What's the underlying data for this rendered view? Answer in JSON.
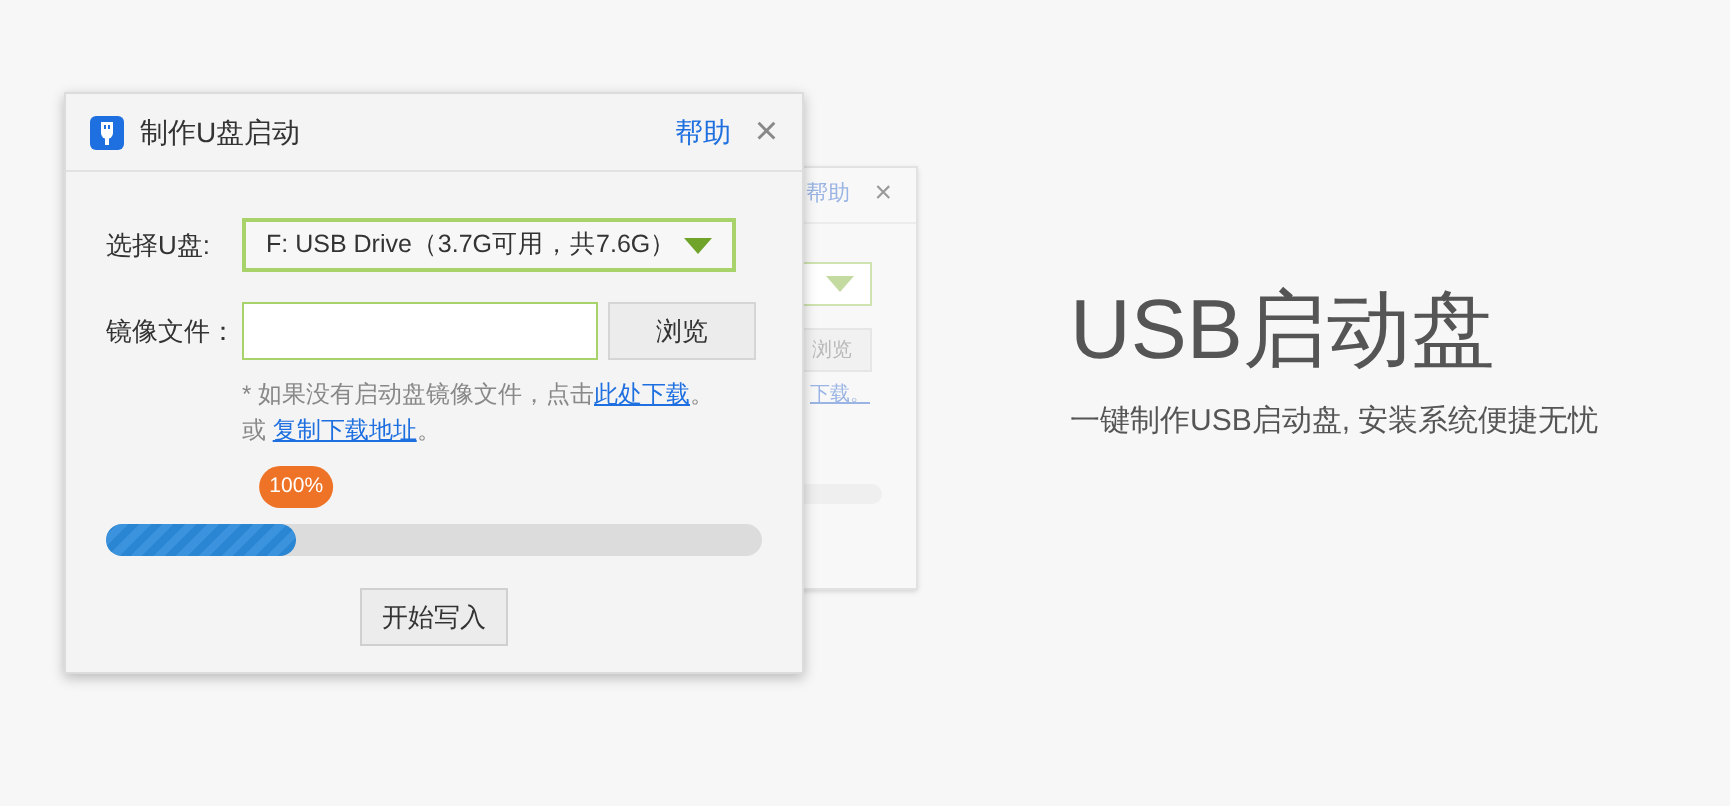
{
  "ghost_window": {
    "help": "帮助",
    "close": "×",
    "browse": "浏览",
    "link": "下载。"
  },
  "dialog": {
    "title": "制作U盘启动",
    "help": "帮助",
    "close": "×",
    "drive_label": "选择U盘:",
    "drive_value": "F: USB Drive（3.7G可用，共7.6G）",
    "image_label": "镜像文件：",
    "browse": "浏览",
    "hint": "* 如果没有启动盘镜像文件，点击",
    "hint_link": "此处下载",
    "hint_end": "。",
    "or": "或",
    "copy_link": "复制下载地址",
    "copy_end": "。",
    "progress": {
      "level": 0.29,
      "badge": "100%"
    },
    "start": "开始写入"
  },
  "hero": {
    "title": "USB启动盘",
    "subtitle": "一键制作USB启动盘, 安装系统便捷无忧"
  }
}
